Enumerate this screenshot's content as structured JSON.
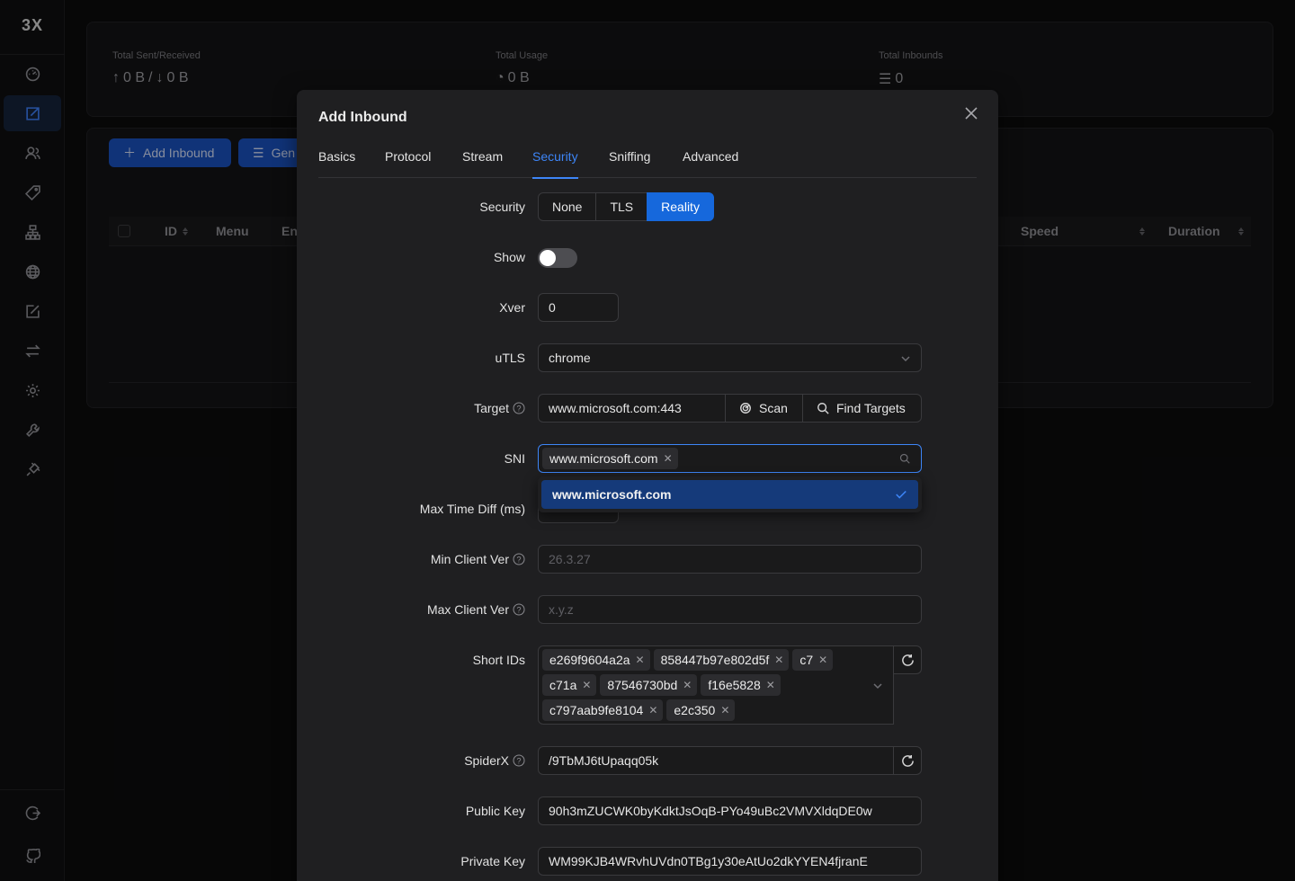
{
  "sidebar": {
    "logo": "3X",
    "items": [
      {
        "icon": "dashboard-icon"
      },
      {
        "icon": "inbounds-icon",
        "active": true
      },
      {
        "icon": "clients-icon"
      },
      {
        "icon": "tag-icon"
      },
      {
        "icon": "network-icon"
      },
      {
        "icon": "globe-icon"
      },
      {
        "icon": "edit-icon"
      },
      {
        "icon": "swap-icon"
      },
      {
        "icon": "gear-icon"
      },
      {
        "icon": "tool-icon"
      },
      {
        "icon": "plug-icon"
      }
    ],
    "bottom": [
      {
        "icon": "logout-icon"
      },
      {
        "icon": "github-icon"
      }
    ]
  },
  "stats": {
    "sent_label": "Total Sent/Received",
    "sent_up": "0 B",
    "sent_sep": "/",
    "sent_down": "0 B",
    "usage_label": "Total Usage",
    "usage_value": "0 B",
    "inbounds_label": "Total Inbounds",
    "inbounds_value": "0"
  },
  "toolbar": {
    "add_inbound": "Add Inbound",
    "general": "Gen"
  },
  "table": {
    "headers": [
      "ID",
      "Menu",
      "En",
      "Speed",
      "Duration"
    ]
  },
  "modal": {
    "title": "Add Inbound",
    "tabs": [
      "Basics",
      "Protocol",
      "Stream",
      "Security",
      "Sniffing",
      "Advanced"
    ],
    "active_tab": "Security",
    "security": {
      "label": "Security",
      "options": [
        "None",
        "TLS",
        "Reality"
      ],
      "selected": "Reality"
    },
    "show": {
      "label": "Show",
      "on": false
    },
    "xver": {
      "label": "Xver",
      "value": "0"
    },
    "utls": {
      "label": "uTLS",
      "value": "chrome"
    },
    "target": {
      "label": "Target",
      "value": "www.microsoft.com:443",
      "scan": "Scan",
      "find": "Find Targets"
    },
    "sni": {
      "label": "SNI",
      "tags": [
        "www.microsoft.com"
      ],
      "option": "www.microsoft.com"
    },
    "max_time_diff": {
      "label": "Max Time Diff (ms)"
    },
    "min_client": {
      "label": "Min Client Ver",
      "placeholder": "26.3.27"
    },
    "max_client": {
      "label": "Max Client Ver",
      "placeholder": "x.y.z"
    },
    "short_ids": {
      "label": "Short IDs",
      "rows": [
        [
          "e269f9604a2a",
          "858447b97e802d5f",
          "c7"
        ],
        [
          "c71a",
          "87546730bd",
          "f16e5828"
        ],
        [
          "c797aab9fe8104",
          "e2c350"
        ]
      ]
    },
    "spiderx": {
      "label": "SpiderX",
      "value": "/9TbMJ6tUpaqq05k"
    },
    "public_key": {
      "label": "Public Key",
      "value": "90h3mZUCWK0byKdktJsOqB-PYo49uBc2VMVXldqDE0w"
    },
    "private_key": {
      "label": "Private Key",
      "value": "WM99KJB4WRvhUVdn0TBg1y30eAtUo2dkYYEN4fjranE"
    }
  }
}
